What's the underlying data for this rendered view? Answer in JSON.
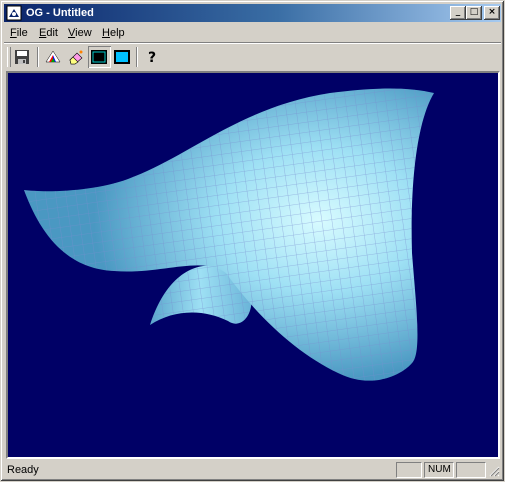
{
  "window": {
    "title": "OG - Untitled",
    "minimize_glyph": "_",
    "maximize_glyph": "□",
    "close_glyph": "×"
  },
  "menu": [
    {
      "accel": "F",
      "rest": "ile"
    },
    {
      "accel": "E",
      "rest": "dit"
    },
    {
      "accel": "V",
      "rest": "iew"
    },
    {
      "accel": "H",
      "rest": "elp"
    }
  ],
  "toolbar": {
    "buttons": [
      "save-icon",
      "color-prism-icon",
      "eraser-icon",
      "wireframe-window-icon",
      "filled-window-icon",
      "help-icon"
    ],
    "help_glyph": "?"
  },
  "viewport": {
    "background": "#000066",
    "surface_shade_dark": "#4a90b8",
    "surface_shade_light": "#c8f4ff",
    "surface_grid_line": "#8aa8d8"
  },
  "status": {
    "text": "Ready",
    "num_indicator": "NUM"
  }
}
